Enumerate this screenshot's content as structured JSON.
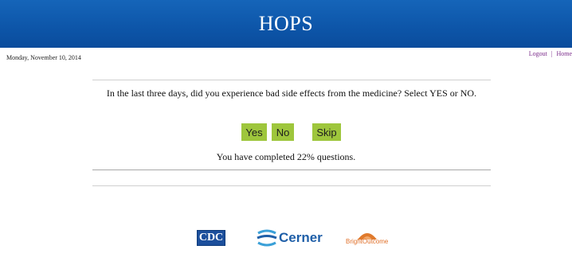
{
  "header": {
    "title": "HOPS"
  },
  "date_text": "Monday, November 10, 2014",
  "top_links": {
    "logout": "Logout",
    "separator": "|",
    "home": "Home"
  },
  "question": {
    "text": "In the last three days, did you experience bad side effects from the medicine? Select YES or NO."
  },
  "answers": {
    "yes": "Yes",
    "no": "No",
    "skip": "Skip"
  },
  "progress": {
    "text": "You have completed 22% questions.",
    "percent": 22
  },
  "logos": {
    "cdc": "CDC",
    "cerner": "Cerner",
    "bright": "BrightOutcome"
  },
  "colors": {
    "header_blue": "#0d55a8",
    "button_green": "#9ec63c",
    "link_purple": "#7a2a8a"
  },
  "icons": {
    "cerner": "cerner-swoosh-icon",
    "bright": "brightoutcome-arc-icon"
  }
}
